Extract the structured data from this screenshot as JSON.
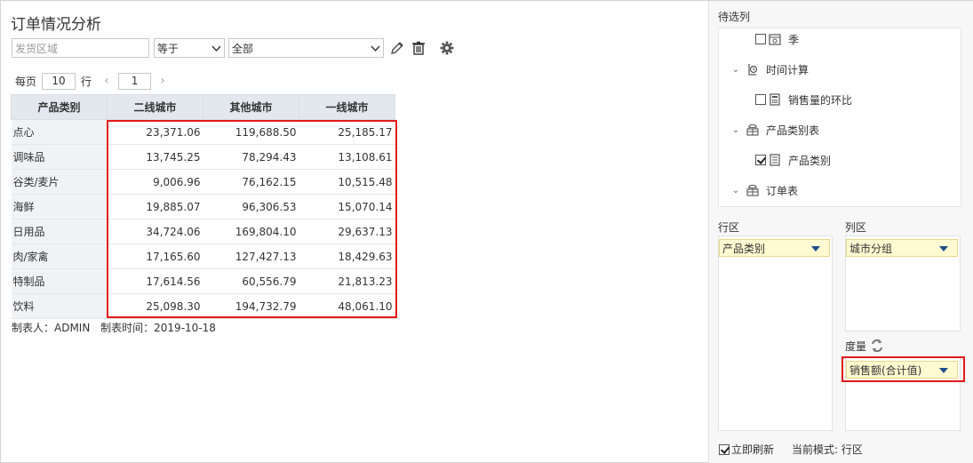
{
  "report": {
    "title": "订单情况分析",
    "filter": {
      "field_placeholder": "发货区域",
      "operator": "等于",
      "value": "全部"
    },
    "pager": {
      "per_page_label": "每页",
      "per_page_value": "10",
      "rows_label": "行",
      "page_value": "1",
      "prev": "‹",
      "next": "›"
    },
    "table": {
      "columns": [
        "产品类别",
        "二线城市",
        "其他城市",
        "一线城市"
      ],
      "rows": [
        {
          "name": "点心",
          "v": [
            "23,371.06",
            "119,688.50",
            "25,185.17"
          ]
        },
        {
          "name": "调味品",
          "v": [
            "13,745.25",
            "78,294.43",
            "13,108.61"
          ]
        },
        {
          "name": "谷类/麦片",
          "v": [
            "9,006.96",
            "76,162.15",
            "10,515.48"
          ]
        },
        {
          "name": "海鲜",
          "v": [
            "19,885.07",
            "96,306.53",
            "15,070.14"
          ]
        },
        {
          "name": "日用品",
          "v": [
            "34,724.06",
            "169,804.10",
            "29,637.13"
          ]
        },
        {
          "name": "肉/家禽",
          "v": [
            "17,165.60",
            "127,427.13",
            "18,429.63"
          ]
        },
        {
          "name": "特制品",
          "v": [
            "17,614.56",
            "60,556.79",
            "21,813.23"
          ]
        },
        {
          "name": "饮料",
          "v": [
            "25,098.30",
            "194,732.79",
            "48,061.10"
          ]
        }
      ]
    },
    "footer": {
      "maker": "制表人：ADMIN",
      "time": "制表时间：2019-10-18"
    }
  },
  "panel": {
    "candidates_title": "待选列",
    "tree": [
      {
        "label": "季",
        "checked": false
      },
      {
        "label": "时间计算"
      },
      {
        "label": "销售量的环比",
        "checked": false
      },
      {
        "label": "产品类别表"
      },
      {
        "label": "产品类别",
        "checked": true
      },
      {
        "label": "订单表"
      }
    ],
    "row_zone_label": "行区",
    "col_zone_label": "列区",
    "measure_label": "度量",
    "row_field": "产品类别",
    "col_field": "城市分组",
    "measure_field": "销售额(合计值)",
    "auto_refresh_label": "立即刷新",
    "mode_text": "当前模式: 行区"
  },
  "colors": {
    "highlight": "#e01b1b",
    "chip_bg": "#fffad1",
    "header_bg": "#e3e8ee"
  }
}
